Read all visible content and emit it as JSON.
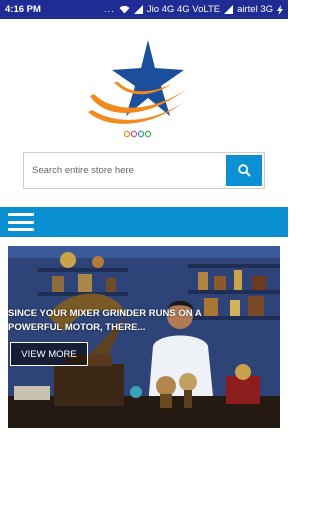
{
  "status_bar": {
    "time": "4:16 PM",
    "dots": "...",
    "carrier1": "Jio 4G 4G VoLTE",
    "carrier2": "airtel 3G",
    "icons": [
      "wifi-icon",
      "signal-icon",
      "signal-icon",
      "battery-charging-icon"
    ]
  },
  "brand": {
    "logo": "star-swoosh-logo",
    "colors": {
      "blue": "#1b4f9c",
      "orange": "#f08a1c"
    }
  },
  "search": {
    "placeholder": "Search entire store here",
    "value": "",
    "button_icon": "search-icon",
    "button_color": "#0d8fd4"
  },
  "nav": {
    "menu_icon": "hamburger-menu-icon",
    "color": "#0a8fd0"
  },
  "hero": {
    "caption": "SINCE YOUR MIXER GRINDER RUNS ON A POWERFUL MOTOR, THERE...",
    "button_label": "VIEW MORE"
  }
}
